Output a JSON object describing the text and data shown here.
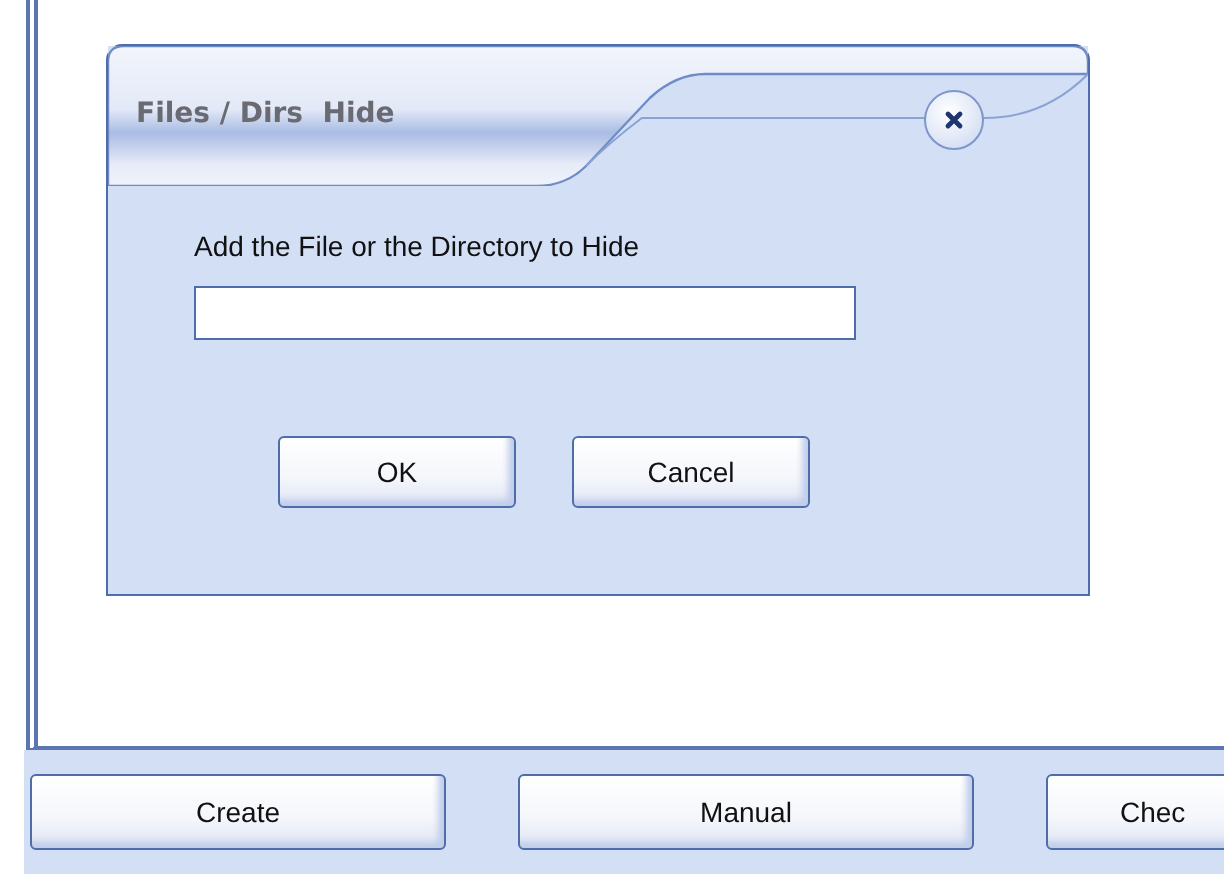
{
  "dialog": {
    "title": "Files / Dirs  Hide",
    "label": "Add the File or the Directory to Hide",
    "buttons": [
      "OK",
      "Cancel"
    ]
  },
  "bottom_buttons": [
    "Create",
    "Manual",
    "Chec"
  ]
}
